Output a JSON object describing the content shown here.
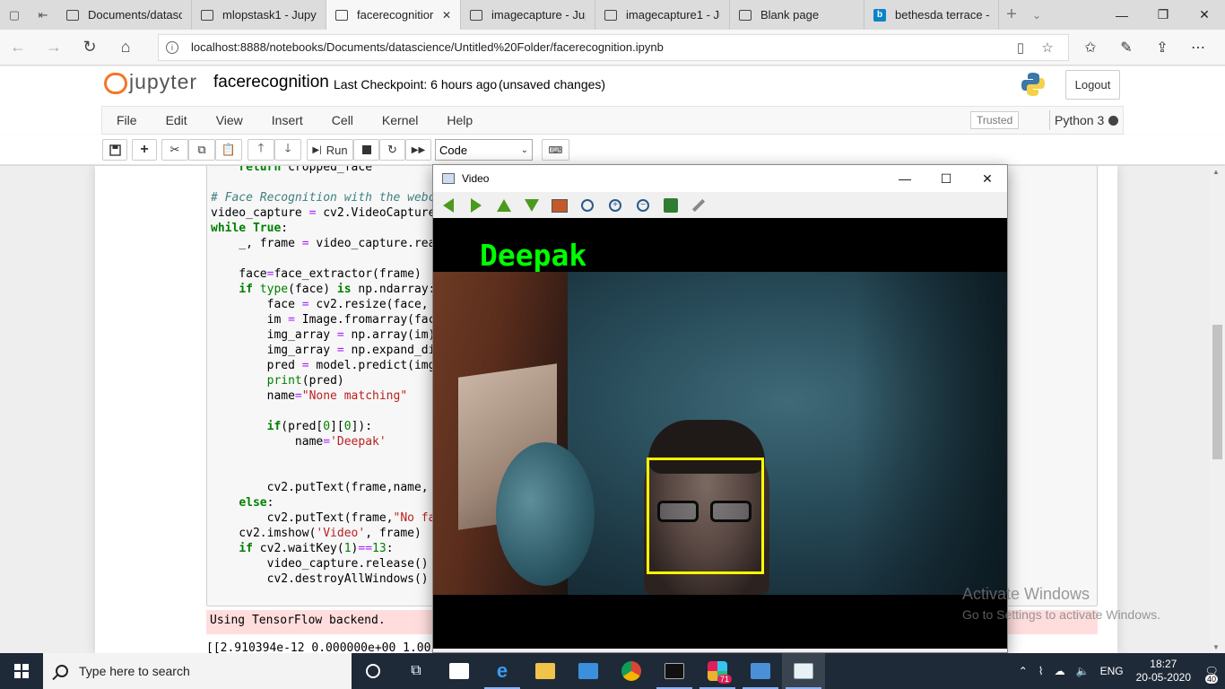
{
  "browser": {
    "tabs": [
      {
        "title": "Documents/datasc",
        "active": false
      },
      {
        "title": "mlopstask1 - Jupyt",
        "active": false
      },
      {
        "title": "facerecognitior",
        "active": true
      },
      {
        "title": "imagecapture - Jup",
        "active": false
      },
      {
        "title": "imagecapture1 - Ju",
        "active": false
      },
      {
        "title": "Blank page",
        "active": false
      },
      {
        "title": "bethesda terrace -",
        "active": false
      }
    ],
    "url": "localhost:8888/notebooks/Documents/datascience/Untitled%20Folder/facerecognition.ipynb"
  },
  "jupyter": {
    "logo_text": "jupyter",
    "notebook_title": "facerecognition",
    "checkpoint": "Last Checkpoint: 6 hours ago",
    "unsaved": "(unsaved changes)",
    "logout": "Logout",
    "menu": [
      "File",
      "Edit",
      "View",
      "Insert",
      "Cell",
      "Kernel",
      "Help"
    ],
    "trusted": "Trusted",
    "kernel": "Python 3",
    "toolbar": {
      "run_label": "Run",
      "cell_type": "Code"
    }
  },
  "notebook": {
    "code_lines": [
      {
        "text": "    return cropped_face",
        "tokens": [
          [
            "    ",
            ""
          ],
          [
            "return",
            "kw"
          ],
          [
            " cropped_face",
            ""
          ]
        ]
      },
      {
        "text": "",
        "tokens": []
      },
      {
        "text": "# Face Recognition with the webca",
        "tokens": [
          [
            "# Face Recognition with the webca",
            "cm"
          ]
        ]
      },
      {
        "text": "video_capture = cv2.VideoCapture",
        "tokens": [
          [
            "video_capture ",
            ""
          ],
          [
            "=",
            "op"
          ],
          [
            " cv2.VideoCapture",
            ""
          ]
        ]
      },
      {
        "text": "while True:",
        "tokens": [
          [
            "while",
            "kw"
          ],
          [
            " ",
            ""
          ],
          [
            "True",
            "kw"
          ],
          [
            ":",
            ""
          ]
        ]
      },
      {
        "text": "    _, frame = video_capture.read",
        "tokens": [
          [
            "    _, frame ",
            ""
          ],
          [
            "=",
            "op"
          ],
          [
            " video_capture.read",
            ""
          ]
        ]
      },
      {
        "text": "",
        "tokens": []
      },
      {
        "text": "    face=face_extractor(frame)",
        "tokens": [
          [
            "    face",
            ""
          ],
          [
            "=",
            "op"
          ],
          [
            "face_extractor(frame)",
            ""
          ]
        ]
      },
      {
        "text": "    if type(face) is np.ndarray:",
        "tokens": [
          [
            "    ",
            ""
          ],
          [
            "if",
            "kw"
          ],
          [
            " ",
            ""
          ],
          [
            "type",
            "bi"
          ],
          [
            "(face) ",
            ""
          ],
          [
            "is",
            "kw"
          ],
          [
            " np.ndarray:",
            ""
          ]
        ]
      },
      {
        "text": "        face = cv2.resize(face, (",
        "tokens": [
          [
            "        face ",
            ""
          ],
          [
            "=",
            "op"
          ],
          [
            " cv2.resize(face, (",
            ""
          ]
        ]
      },
      {
        "text": "        im = Image.fromarray(face",
        "tokens": [
          [
            "        im ",
            ""
          ],
          [
            "=",
            "op"
          ],
          [
            " Image.fromarray(face",
            ""
          ]
        ]
      },
      {
        "text": "        img_array = np.array(im)",
        "tokens": [
          [
            "        img_array ",
            ""
          ],
          [
            "=",
            "op"
          ],
          [
            " np.array(im)",
            ""
          ]
        ]
      },
      {
        "text": "        img_array = np.expand_dim",
        "tokens": [
          [
            "        img_array ",
            ""
          ],
          [
            "=",
            "op"
          ],
          [
            " np.expand_dim",
            ""
          ]
        ]
      },
      {
        "text": "        pred = model.predict(img_",
        "tokens": [
          [
            "        pred ",
            ""
          ],
          [
            "=",
            "op"
          ],
          [
            " model.predict(img_",
            ""
          ]
        ]
      },
      {
        "text": "        print(pred)",
        "tokens": [
          [
            "        ",
            ""
          ],
          [
            "print",
            "bi"
          ],
          [
            "(pred)",
            ""
          ]
        ]
      },
      {
        "text": "        name=\"None matching\"",
        "tokens": [
          [
            "        name",
            ""
          ],
          [
            "=",
            "op"
          ],
          [
            "\"None matching\"",
            "st"
          ]
        ]
      },
      {
        "text": "",
        "tokens": []
      },
      {
        "text": "        if(pred[0][0]):",
        "tokens": [
          [
            "        ",
            ""
          ],
          [
            "if",
            "kw"
          ],
          [
            "(pred[",
            ""
          ],
          [
            "0",
            "nm"
          ],
          [
            "][",
            ""
          ],
          [
            "0",
            "nm"
          ],
          [
            "]):",
            ""
          ]
        ]
      },
      {
        "text": "            name='Deepak'",
        "tokens": [
          [
            "            name",
            ""
          ],
          [
            "=",
            "op"
          ],
          [
            "'Deepak'",
            "st"
          ]
        ]
      },
      {
        "text": "",
        "tokens": []
      },
      {
        "text": "",
        "tokens": []
      },
      {
        "text": "        cv2.putText(frame,name,",
        "tokens": [
          [
            "        cv2.putText(frame,name,",
            ""
          ]
        ]
      },
      {
        "text": "    else:",
        "tokens": [
          [
            "    ",
            ""
          ],
          [
            "else",
            "kw"
          ],
          [
            ":",
            ""
          ]
        ]
      },
      {
        "text": "        cv2.putText(frame,\"No fa",
        "tokens": [
          [
            "        cv2.putText(frame,",
            ""
          ],
          [
            "\"No fa",
            "st"
          ]
        ]
      },
      {
        "text": "    cv2.imshow('Video', frame)",
        "tokens": [
          [
            "    cv2.imshow(",
            ""
          ],
          [
            "'Video'",
            "st"
          ],
          [
            ", frame)",
            ""
          ]
        ]
      },
      {
        "text": "    if cv2.waitKey(1)==13:",
        "tokens": [
          [
            "    ",
            ""
          ],
          [
            "if",
            "kw"
          ],
          [
            " cv2.waitKey(",
            ""
          ],
          [
            "1",
            "nm"
          ],
          [
            ")",
            ""
          ],
          [
            "==",
            "op"
          ],
          [
            "13",
            "nm"
          ],
          [
            ":",
            ""
          ]
        ]
      },
      {
        "text": "        video_capture.release()",
        "tokens": [
          [
            "        video_capture.release()",
            ""
          ]
        ]
      },
      {
        "text": "        cv2.destroyAllWindows()",
        "tokens": [
          [
            "        cv2.destroyAllWindows()",
            ""
          ]
        ]
      }
    ],
    "stderr": "Using TensorFlow backend.",
    "output": "[[2.910394e-12 0.000000e+00 1.00"
  },
  "video_window": {
    "title": "Video",
    "overlay_name": "Deepak",
    "overlay_color": "#00ff00",
    "box_color": "#ffff00"
  },
  "watermark": {
    "line1": "Activate Windows",
    "line2": "Go to Settings to activate Windows."
  },
  "taskbar": {
    "search_placeholder": "Type here to search",
    "language": "ENG",
    "time": "18:27",
    "date": "20-05-2020",
    "notification_count": "40",
    "slack_badge": "71"
  }
}
